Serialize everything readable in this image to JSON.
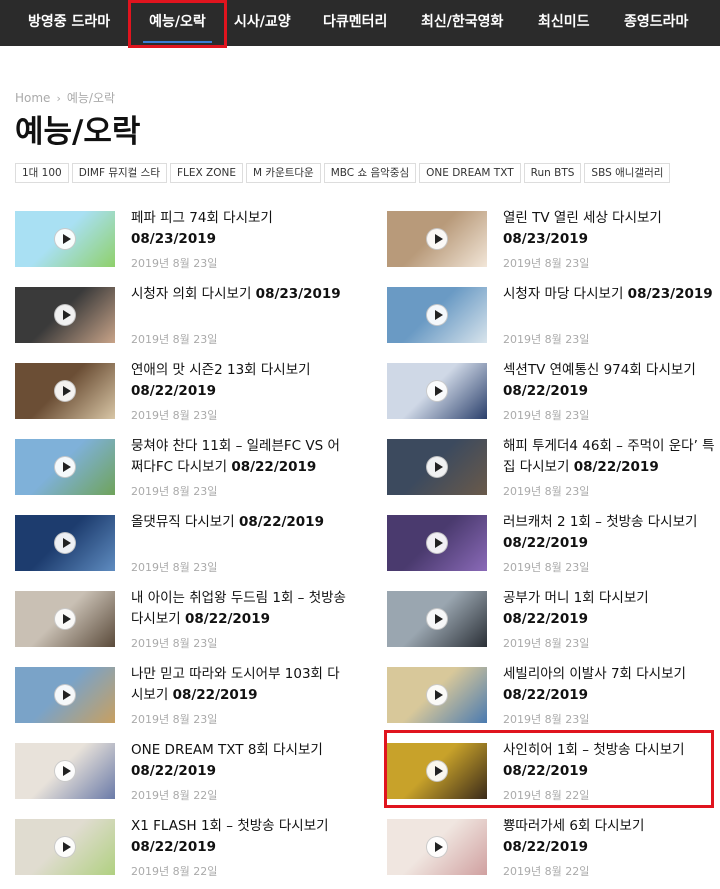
{
  "nav": {
    "items": [
      {
        "label": "방영중 드라마"
      },
      {
        "label": "예능/오락",
        "active": true
      },
      {
        "label": "시사/교양"
      },
      {
        "label": "다큐멘터리"
      },
      {
        "label": "최신/한국영화"
      },
      {
        "label": "최신미드"
      },
      {
        "label": "종영드라마"
      }
    ]
  },
  "breadcrumb": {
    "home": "Home",
    "current": "예능/오락"
  },
  "page_title": "예능/오락",
  "tags": [
    "1대 100",
    "DIMF 뮤지컬 스타",
    "FLEX ZONE",
    "M 카운트다운",
    "MBC 쇼 음악중심",
    "ONE DREAM TXT",
    "Run BTS",
    "SBS 애니갤러리"
  ],
  "posts": [
    {
      "title": "페파 피그 74회 다시보기",
      "date": "08/23/2019",
      "meta": "2019년 8월 23일",
      "thumb": [
        "#a9e0f3",
        "#8fd06a"
      ]
    },
    {
      "title": "열린 TV 열린 세상 다시보기",
      "date": "08/23/2019",
      "meta": "2019년 8월 23일",
      "thumb": [
        "#b89a7a",
        "#f2e6d8"
      ]
    },
    {
      "title": "시청자 의회 다시보기",
      "date": "08/23/2019",
      "meta": "2019년 8월 23일",
      "thumb": [
        "#3a3a3a",
        "#c9a489"
      ]
    },
    {
      "title": "시청자 마당 다시보기",
      "date": "08/23/2019",
      "meta": "2019년 8월 23일",
      "thumb": [
        "#6a9ac4",
        "#d8e4ec"
      ]
    },
    {
      "title": "연애의 맛 시즌2 13회 다시보기",
      "date": "08/22/2019",
      "meta": "2019년 8월 23일",
      "thumb": [
        "#6b4e35",
        "#d8c6a6"
      ]
    },
    {
      "title": "섹션TV 연예통신 974회 다시보기",
      "date": "08/22/2019",
      "meta": "2019년 8월 23일",
      "thumb": [
        "#cfd8e6",
        "#2a3f6b"
      ]
    },
    {
      "title": "뭉쳐야 찬다 11회 – 일레븐FC VS 어쩌다FC 다시보기",
      "date": "08/22/2019",
      "meta": "2019년 8월 23일",
      "thumb": [
        "#7fb1d9",
        "#6fa35a"
      ]
    },
    {
      "title": "해피 투게더4 46회 – 주먹이 운다’ 특집 다시보기",
      "date": "08/22/2019",
      "meta": "2019년 8월 23일",
      "thumb": [
        "#3c4a5e",
        "#6a5a4a"
      ]
    },
    {
      "title": "올댓뮤직 다시보기",
      "date": "08/22/2019",
      "meta": "2019년 8월 23일",
      "thumb": [
        "#1d3c6e",
        "#5f8cc0"
      ]
    },
    {
      "title": "러브캐처 2 1회 – 첫방송 다시보기",
      "date": "08/22/2019",
      "meta": "2019년 8월 23일",
      "thumb": [
        "#4a3a6e",
        "#8a6ab8"
      ]
    },
    {
      "title": "내 아이는 취업왕 두드림 1회 – 첫방송 다시보기",
      "date": "08/22/2019",
      "meta": "2019년 8월 23일",
      "thumb": [
        "#c9c0b4",
        "#5a4a3a"
      ]
    },
    {
      "title": "공부가 머니 1회 다시보기",
      "date": "08/22/2019",
      "meta": "2019년 8월 23일",
      "thumb": [
        "#9aa6b0",
        "#2a2f36"
      ]
    },
    {
      "title": "나만 믿고 따라와 도시어부 103회 다시보기",
      "date": "08/22/2019",
      "meta": "2019년 8월 23일",
      "thumb": [
        "#7aa3c8",
        "#c8a060"
      ]
    },
    {
      "title": "세빌리아의 이발사 7회 다시보기",
      "date": "08/22/2019",
      "meta": "2019년 8월 23일",
      "thumb": [
        "#d8c89a",
        "#4a7ab0"
      ]
    },
    {
      "title": "ONE DREAM TXT 8회 다시보기",
      "date": "08/22/2019",
      "meta": "2019년 8월 22일",
      "thumb": [
        "#e8e2da",
        "#6a7aa8"
      ]
    },
    {
      "title": "사인히어 1회 – 첫방송 다시보기",
      "date": "08/22/2019",
      "meta": "2019년 8월 22일",
      "thumb": [
        "#c8a22a",
        "#3a2a1a"
      ]
    },
    {
      "title": "X1 FLASH 1회 – 첫방송 다시보기",
      "date": "08/22/2019",
      "meta": "2019년 8월 22일",
      "thumb": [
        "#e0dcd0",
        "#b0d080"
      ]
    },
    {
      "title": "뿅따러가세 6회 다시보기",
      "date": "08/22/2019",
      "meta": "2019년 8월 22일",
      "thumb": [
        "#f0e6e0",
        "#d0a0a0"
      ]
    }
  ]
}
